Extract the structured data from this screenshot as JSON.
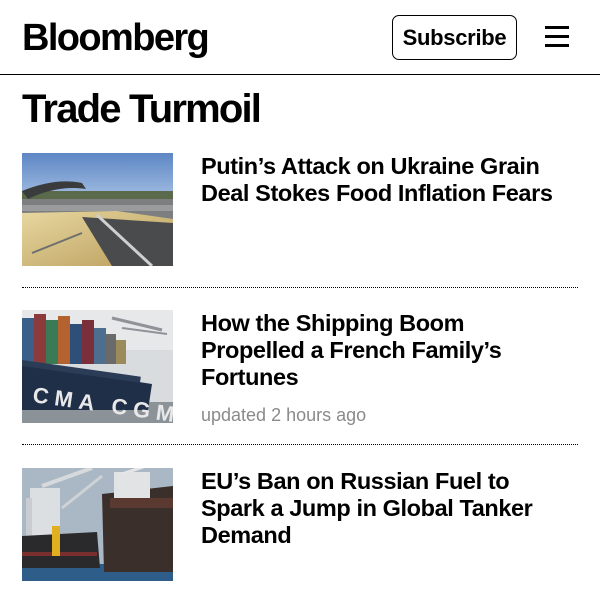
{
  "header": {
    "brand": "Bloomberg",
    "subscribe_label": "Subscribe",
    "menu_icon": "hamburger-menu-icon"
  },
  "section": {
    "title": "Trade Turmoil"
  },
  "stories": [
    {
      "headline": "Putin’s Attack on Ukraine Grain Deal Stokes Food Inflation Fears",
      "updated": "",
      "image": "grain-loading-photo"
    },
    {
      "headline": "How the Shipping Boom Propelled a French Family’s Fortunes",
      "updated": "updated 2 hours ago",
      "image": "container-ship-photo",
      "image_text": "CMA CGM"
    },
    {
      "headline": "EU’s Ban on Russian Fuel to Spark a Jump in Global Tanker Demand",
      "updated": "",
      "image": "tanker-ships-photo"
    }
  ],
  "colors": {
    "text": "#000000",
    "meta": "#8a8a8a",
    "background": "#ffffff"
  }
}
